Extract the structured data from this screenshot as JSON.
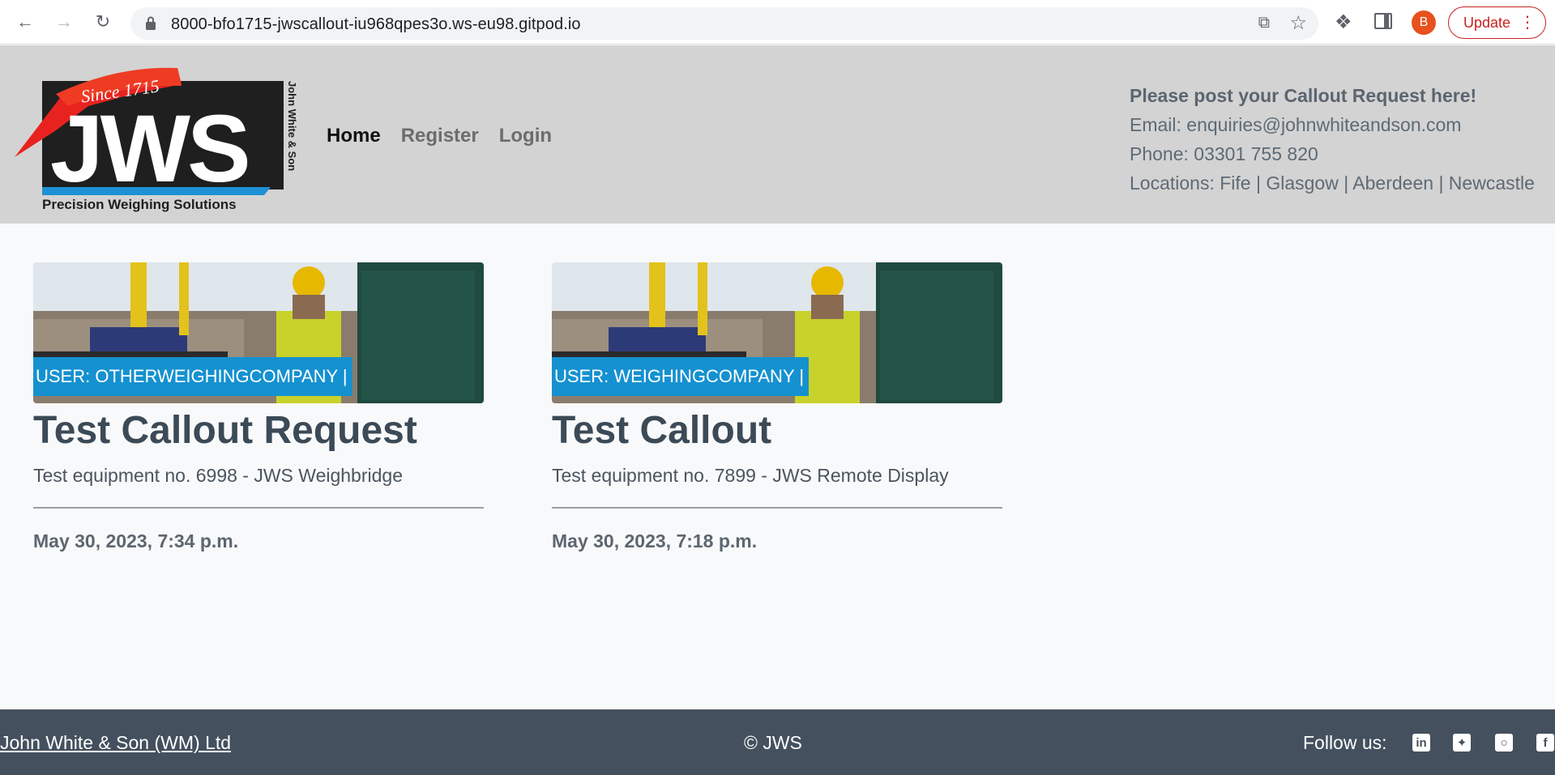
{
  "browser": {
    "url": "8000-bfo1715-jwscallout-iu968qpes3o.ws-eu98.gitpod.io",
    "profile_initial": "B",
    "update_label": "Update"
  },
  "header": {
    "logo": {
      "since": "Since 1715",
      "brand": "JWS",
      "side_text": "John White & Son",
      "tagline": "Precision Weighing Solutions"
    },
    "nav": [
      {
        "label": "Home",
        "active": true
      },
      {
        "label": "Register",
        "active": false
      },
      {
        "label": "Login",
        "active": false
      }
    ],
    "contact": {
      "headline": "Please post your Callout Request here!",
      "email": "Email: enquiries@johnwhiteandson.com",
      "phone": "Phone: 03301 755 820",
      "locations": "Locations: Fife | Glasgow | Aberdeen | Newcastle"
    }
  },
  "callouts": [
    {
      "user": "USER: OTHERWEIGHINGCOMPANY |",
      "title": "Test Callout Request",
      "description": "Test equipment no. 6998 - JWS Weighbridge",
      "date": "May 30, 2023, 7:34 p.m."
    },
    {
      "user": "USER: WEIGHINGCOMPANY |",
      "title": "Test Callout",
      "description": "Test equipment no. 7899 - JWS Remote Display",
      "date": "May 30, 2023, 7:18 p.m."
    }
  ],
  "footer": {
    "company": "John White & Son (WM) Ltd",
    "copyright": "© JWS",
    "follow": "Follow us:",
    "social": [
      "linkedin-icon",
      "twitter-icon",
      "instagram-icon",
      "facebook-icon"
    ]
  },
  "colors": {
    "header_bg": "#d3d3d3",
    "badge": "#1591d0",
    "footer_bg": "#44505e",
    "logo_red": "#e8231f",
    "logo_blue": "#1e90d6"
  }
}
